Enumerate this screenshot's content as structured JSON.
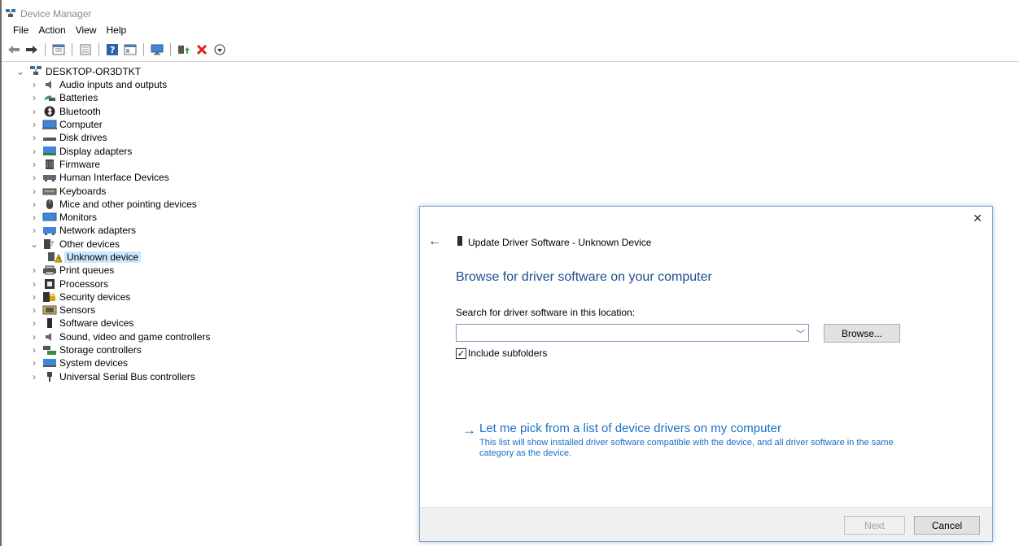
{
  "window": {
    "title": "Device Manager",
    "icon": "device-manager-icon"
  },
  "menu": [
    "File",
    "Action",
    "View",
    "Help"
  ],
  "toolbar": [
    {
      "name": "back-icon"
    },
    {
      "name": "forward-icon"
    },
    {
      "name": "show-hide-tree-icon"
    },
    {
      "name": "properties-icon"
    },
    {
      "name": "help-icon"
    },
    {
      "name": "view-icon"
    },
    {
      "name": "monitor-icon"
    },
    {
      "name": "update-driver-icon"
    },
    {
      "name": "uninstall-icon"
    },
    {
      "name": "disable-device-icon"
    }
  ],
  "tree": {
    "root": "DESKTOP-OR3DTKT",
    "items": [
      {
        "label": "Audio inputs and outputs",
        "icon": "speaker-icon"
      },
      {
        "label": "Batteries",
        "icon": "battery-icon"
      },
      {
        "label": "Bluetooth",
        "icon": "bluetooth-icon"
      },
      {
        "label": "Computer",
        "icon": "computer-icon"
      },
      {
        "label": "Disk drives",
        "icon": "disk-drive-icon"
      },
      {
        "label": "Display adapters",
        "icon": "display-adapter-icon"
      },
      {
        "label": "Firmware",
        "icon": "firmware-icon"
      },
      {
        "label": "Human Interface Devices",
        "icon": "hid-icon"
      },
      {
        "label": "Keyboards",
        "icon": "keyboard-icon"
      },
      {
        "label": "Mice and other pointing devices",
        "icon": "mouse-icon"
      },
      {
        "label": "Monitors",
        "icon": "monitor-icon"
      },
      {
        "label": "Network adapters",
        "icon": "network-adapter-icon"
      },
      {
        "label": "Other devices",
        "icon": "other-devices-icon",
        "expanded": true
      },
      {
        "label": "Unknown device",
        "icon": "unknown-device-warning-icon",
        "child": true,
        "selected": true
      },
      {
        "label": "Print queues",
        "icon": "printer-icon"
      },
      {
        "label": "Processors",
        "icon": "processor-icon"
      },
      {
        "label": "Security devices",
        "icon": "security-device-icon"
      },
      {
        "label": "Sensors",
        "icon": "sensor-icon"
      },
      {
        "label": "Software devices",
        "icon": "software-device-icon"
      },
      {
        "label": "Sound, video and game controllers",
        "icon": "speaker-icon"
      },
      {
        "label": "Storage controllers",
        "icon": "storage-controller-icon"
      },
      {
        "label": "System devices",
        "icon": "system-devices-icon"
      },
      {
        "label": "Universal Serial Bus controllers",
        "icon": "usb-icon"
      }
    ]
  },
  "dialog": {
    "title": "Update Driver Software - Unknown Device",
    "heading": "Browse for driver software on your computer",
    "search_label": "Search for driver software in this location:",
    "path_value": "",
    "browse_label": "Browse...",
    "include_subfolders_label": "Include subfolders",
    "include_subfolders_checked": true,
    "pick_title": "Let me pick from a list of device drivers on my computer",
    "pick_desc": "This list will show installed driver software compatible with the device, and all driver software in the same category as the device.",
    "next_label": "Next",
    "cancel_label": "Cancel"
  }
}
